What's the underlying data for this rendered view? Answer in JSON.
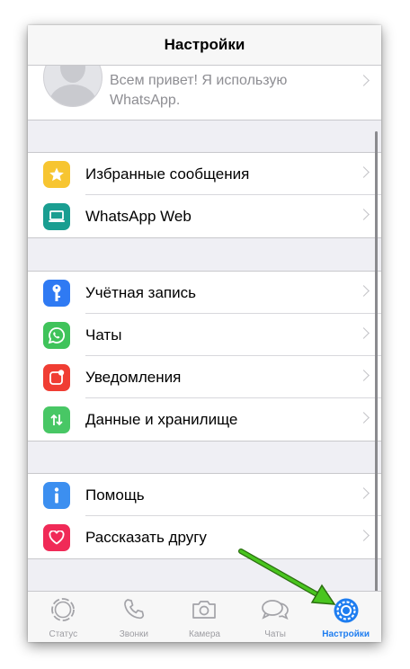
{
  "header": {
    "title": "Настройки"
  },
  "profile": {
    "status": "Всем привет! Я использую WhatsApp."
  },
  "groups": [
    {
      "items": [
        {
          "label": "Избранные сообщения",
          "icon": "star-icon",
          "color": "#f7c531"
        },
        {
          "label": "WhatsApp Web",
          "icon": "laptop-icon",
          "color": "#1a9e91"
        }
      ]
    },
    {
      "items": [
        {
          "label": "Учётная запись",
          "icon": "key-icon",
          "color": "#2f7af3"
        },
        {
          "label": "Чаты",
          "icon": "whatsapp-icon",
          "color": "#3fc35a"
        },
        {
          "label": "Уведомления",
          "icon": "notification-icon",
          "color": "#f03d33"
        },
        {
          "label": "Данные и хранилище",
          "icon": "data-transfer-icon",
          "color": "#48c765"
        }
      ]
    },
    {
      "items": [
        {
          "label": "Помощь",
          "icon": "info-icon",
          "color": "#3c8ff0"
        },
        {
          "label": "Рассказать другу",
          "icon": "heart-icon",
          "color": "#f02a57"
        }
      ]
    }
  ],
  "tabbar": {
    "tabs": [
      {
        "label": "Статус",
        "icon": "status-icon",
        "active": false
      },
      {
        "label": "Звонки",
        "icon": "phone-icon",
        "active": false
      },
      {
        "label": "Камера",
        "icon": "camera-icon",
        "active": false
      },
      {
        "label": "Чаты",
        "icon": "chat-bubbles-icon",
        "active": false
      },
      {
        "label": "Настройки",
        "icon": "gear-icon",
        "active": true
      }
    ]
  },
  "colors": {
    "accent": "#1e7df0",
    "arrow": "#49c51f"
  }
}
